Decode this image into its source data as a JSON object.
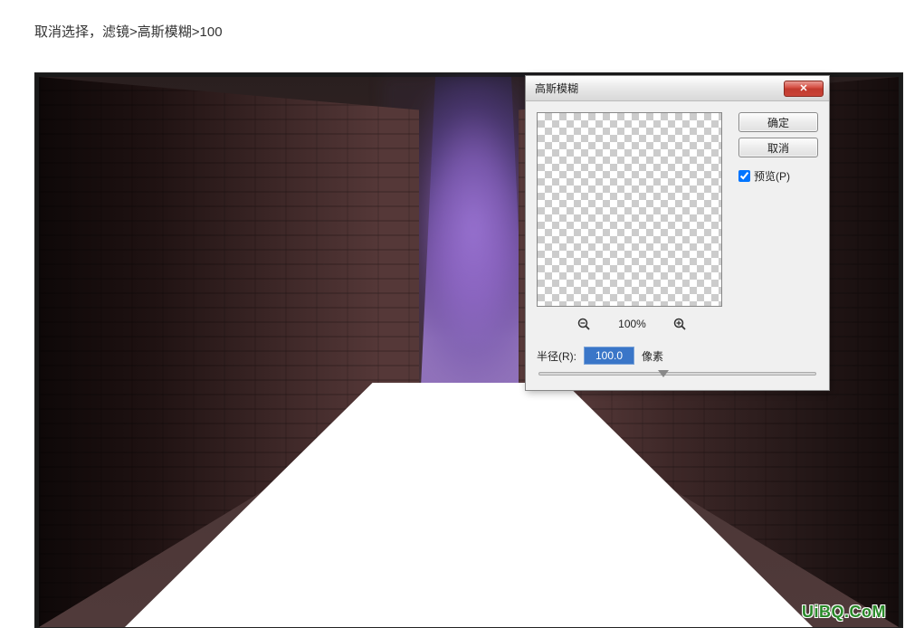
{
  "instruction_text": "取消选择，滤镜>高斯模糊>100",
  "watermark_text": "UiBQ.CoM",
  "dialog": {
    "title": "高斯模糊",
    "close_symbol": "✕",
    "ok_label": "确定",
    "cancel_label": "取消",
    "preview_label": "预览(P)",
    "preview_checked": true,
    "zoom_level": "100%",
    "radius_label": "半径(R):",
    "radius_value": "100.0",
    "radius_unit": "像素",
    "slider_position_pct": 45
  }
}
